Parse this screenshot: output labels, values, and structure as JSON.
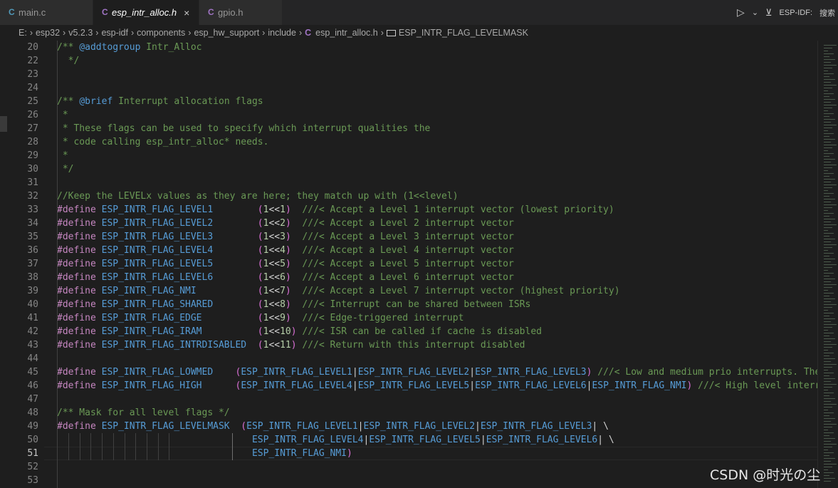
{
  "tabs": [
    {
      "icon": "C",
      "label": "main.c",
      "active": false
    },
    {
      "icon": "C",
      "label": "esp_intr_alloc.h",
      "active": true,
      "close": "×"
    },
    {
      "icon": "C",
      "label": "gpio.h",
      "active": false
    }
  ],
  "toolbar": {
    "run_icon": "run-debug-icon",
    "dropdown": "⌄",
    "esp_idf_label": "ESP-IDF:",
    "search_label": "搜索"
  },
  "breadcrumb": [
    "E:",
    "esp32",
    "v5.2.3",
    "esp-idf",
    "components",
    "esp_hw_support",
    "include",
    "esp_intr_alloc.h",
    "ESP_INTR_FLAG_LEVELMASK"
  ],
  "lines": [
    {
      "n": "20",
      "segs": [
        {
          "t": "/** ",
          "c": "cm"
        },
        {
          "t": "@addtogroup",
          "c": "tag"
        },
        {
          "t": " Intr_Alloc",
          "c": "cm"
        }
      ]
    },
    {
      "n": "22",
      "segs": [
        {
          "t": "  */",
          "c": "cm"
        }
      ]
    },
    {
      "n": "23",
      "segs": []
    },
    {
      "n": "24",
      "segs": []
    },
    {
      "n": "25",
      "segs": [
        {
          "t": "/** ",
          "c": "cm"
        },
        {
          "t": "@brief",
          "c": "tag"
        },
        {
          "t": " Interrupt allocation flags",
          "c": "cm"
        }
      ]
    },
    {
      "n": "26",
      "segs": [
        {
          "t": " *",
          "c": "cm"
        }
      ]
    },
    {
      "n": "27",
      "segs": [
        {
          "t": " * These flags can be used to specify which interrupt qualities the",
          "c": "cm"
        }
      ]
    },
    {
      "n": "28",
      "segs": [
        {
          "t": " * code calling esp_intr_alloc* needs.",
          "c": "cm"
        }
      ]
    },
    {
      "n": "29",
      "segs": [
        {
          "t": " *",
          "c": "cm"
        }
      ]
    },
    {
      "n": "30",
      "segs": [
        {
          "t": " */",
          "c": "cm"
        }
      ]
    },
    {
      "n": "31",
      "segs": []
    },
    {
      "n": "32",
      "segs": [
        {
          "t": "//Keep the LEVELx values as they are here; they match up with (1<<level)",
          "c": "cm"
        }
      ]
    },
    {
      "n": "33",
      "segs": [
        {
          "t": "#define",
          "c": "kw"
        },
        {
          "t": " "
        },
        {
          "t": "ESP_INTR_FLAG_LEVEL1",
          "c": "mac"
        },
        {
          "t": "        "
        },
        {
          "t": "(",
          "c": "par"
        },
        {
          "t": "1",
          "c": "num"
        },
        {
          "t": "<<"
        },
        {
          "t": "1",
          "c": "num"
        },
        {
          "t": ")",
          "c": "par"
        },
        {
          "t": "  ///< Accept a Level 1 interrupt vector (lowest priority)",
          "c": "cm"
        }
      ]
    },
    {
      "n": "34",
      "segs": [
        {
          "t": "#define",
          "c": "kw"
        },
        {
          "t": " "
        },
        {
          "t": "ESP_INTR_FLAG_LEVEL2",
          "c": "mac"
        },
        {
          "t": "        "
        },
        {
          "t": "(",
          "c": "par"
        },
        {
          "t": "1",
          "c": "num"
        },
        {
          "t": "<<"
        },
        {
          "t": "2",
          "c": "num"
        },
        {
          "t": ")",
          "c": "par"
        },
        {
          "t": "  ///< Accept a Level 2 interrupt vector",
          "c": "cm"
        }
      ]
    },
    {
      "n": "35",
      "segs": [
        {
          "t": "#define",
          "c": "kw"
        },
        {
          "t": " "
        },
        {
          "t": "ESP_INTR_FLAG_LEVEL3",
          "c": "mac"
        },
        {
          "t": "        "
        },
        {
          "t": "(",
          "c": "par"
        },
        {
          "t": "1",
          "c": "num"
        },
        {
          "t": "<<"
        },
        {
          "t": "3",
          "c": "num"
        },
        {
          "t": ")",
          "c": "par"
        },
        {
          "t": "  ///< Accept a Level 3 interrupt vector",
          "c": "cm"
        }
      ]
    },
    {
      "n": "36",
      "segs": [
        {
          "t": "#define",
          "c": "kw"
        },
        {
          "t": " "
        },
        {
          "t": "ESP_INTR_FLAG_LEVEL4",
          "c": "mac"
        },
        {
          "t": "        "
        },
        {
          "t": "(",
          "c": "par"
        },
        {
          "t": "1",
          "c": "num"
        },
        {
          "t": "<<"
        },
        {
          "t": "4",
          "c": "num"
        },
        {
          "t": ")",
          "c": "par"
        },
        {
          "t": "  ///< Accept a Level 4 interrupt vector",
          "c": "cm"
        }
      ]
    },
    {
      "n": "37",
      "segs": [
        {
          "t": "#define",
          "c": "kw"
        },
        {
          "t": " "
        },
        {
          "t": "ESP_INTR_FLAG_LEVEL5",
          "c": "mac"
        },
        {
          "t": "        "
        },
        {
          "t": "(",
          "c": "par"
        },
        {
          "t": "1",
          "c": "num"
        },
        {
          "t": "<<"
        },
        {
          "t": "5",
          "c": "num"
        },
        {
          "t": ")",
          "c": "par"
        },
        {
          "t": "  ///< Accept a Level 5 interrupt vector",
          "c": "cm"
        }
      ]
    },
    {
      "n": "38",
      "segs": [
        {
          "t": "#define",
          "c": "kw"
        },
        {
          "t": " "
        },
        {
          "t": "ESP_INTR_FLAG_LEVEL6",
          "c": "mac"
        },
        {
          "t": "        "
        },
        {
          "t": "(",
          "c": "par"
        },
        {
          "t": "1",
          "c": "num"
        },
        {
          "t": "<<"
        },
        {
          "t": "6",
          "c": "num"
        },
        {
          "t": ")",
          "c": "par"
        },
        {
          "t": "  ///< Accept a Level 6 interrupt vector",
          "c": "cm"
        }
      ]
    },
    {
      "n": "39",
      "segs": [
        {
          "t": "#define",
          "c": "kw"
        },
        {
          "t": " "
        },
        {
          "t": "ESP_INTR_FLAG_NMI",
          "c": "mac"
        },
        {
          "t": "           "
        },
        {
          "t": "(",
          "c": "par"
        },
        {
          "t": "1",
          "c": "num"
        },
        {
          "t": "<<"
        },
        {
          "t": "7",
          "c": "num"
        },
        {
          "t": ")",
          "c": "par"
        },
        {
          "t": "  ///< Accept a Level 7 interrupt vector (highest priority)",
          "c": "cm"
        }
      ]
    },
    {
      "n": "40",
      "segs": [
        {
          "t": "#define",
          "c": "kw"
        },
        {
          "t": " "
        },
        {
          "t": "ESP_INTR_FLAG_SHARED",
          "c": "mac"
        },
        {
          "t": "        "
        },
        {
          "t": "(",
          "c": "par"
        },
        {
          "t": "1",
          "c": "num"
        },
        {
          "t": "<<"
        },
        {
          "t": "8",
          "c": "num"
        },
        {
          "t": ")",
          "c": "par"
        },
        {
          "t": "  ///< Interrupt can be shared between ISRs",
          "c": "cm"
        }
      ]
    },
    {
      "n": "41",
      "segs": [
        {
          "t": "#define",
          "c": "kw"
        },
        {
          "t": " "
        },
        {
          "t": "ESP_INTR_FLAG_EDGE",
          "c": "mac"
        },
        {
          "t": "          "
        },
        {
          "t": "(",
          "c": "par"
        },
        {
          "t": "1",
          "c": "num"
        },
        {
          "t": "<<"
        },
        {
          "t": "9",
          "c": "num"
        },
        {
          "t": ")",
          "c": "par"
        },
        {
          "t": "  ///< Edge-triggered interrupt",
          "c": "cm"
        }
      ]
    },
    {
      "n": "42",
      "segs": [
        {
          "t": "#define",
          "c": "kw"
        },
        {
          "t": " "
        },
        {
          "t": "ESP_INTR_FLAG_IRAM",
          "c": "mac"
        },
        {
          "t": "          "
        },
        {
          "t": "(",
          "c": "par"
        },
        {
          "t": "1",
          "c": "num"
        },
        {
          "t": "<<"
        },
        {
          "t": "10",
          "c": "num"
        },
        {
          "t": ")",
          "c": "par"
        },
        {
          "t": " ///< ISR can be called if cache is disabled",
          "c": "cm"
        }
      ]
    },
    {
      "n": "43",
      "segs": [
        {
          "t": "#define",
          "c": "kw"
        },
        {
          "t": " "
        },
        {
          "t": "ESP_INTR_FLAG_INTRDISABLED",
          "c": "mac"
        },
        {
          "t": "  "
        },
        {
          "t": "(",
          "c": "par"
        },
        {
          "t": "1",
          "c": "num"
        },
        {
          "t": "<<"
        },
        {
          "t": "11",
          "c": "num"
        },
        {
          "t": ")",
          "c": "par"
        },
        {
          "t": " ///< Return with this interrupt disabled",
          "c": "cm"
        }
      ]
    },
    {
      "n": "44",
      "segs": []
    },
    {
      "n": "45",
      "segs": [
        {
          "t": "#define",
          "c": "kw"
        },
        {
          "t": " "
        },
        {
          "t": "ESP_INTR_FLAG_LOWMED",
          "c": "mac"
        },
        {
          "t": "    "
        },
        {
          "t": "(",
          "c": "par"
        },
        {
          "t": "ESP_INTR_FLAG_LEVEL1",
          "c": "mac"
        },
        {
          "t": "|"
        },
        {
          "t": "ESP_INTR_FLAG_LEVEL2",
          "c": "mac"
        },
        {
          "t": "|"
        },
        {
          "t": "ESP_INTR_FLAG_LEVEL3",
          "c": "mac"
        },
        {
          "t": ")",
          "c": "par"
        },
        {
          "t": " ///< Low and medium prio interrupts. These",
          "c": "cm"
        }
      ]
    },
    {
      "n": "46",
      "segs": [
        {
          "t": "#define",
          "c": "kw"
        },
        {
          "t": " "
        },
        {
          "t": "ESP_INTR_FLAG_HIGH",
          "c": "mac"
        },
        {
          "t": "      "
        },
        {
          "t": "(",
          "c": "par"
        },
        {
          "t": "ESP_INTR_FLAG_LEVEL4",
          "c": "mac"
        },
        {
          "t": "|"
        },
        {
          "t": "ESP_INTR_FLAG_LEVEL5",
          "c": "mac"
        },
        {
          "t": "|"
        },
        {
          "t": "ESP_INTR_FLAG_LEVEL6",
          "c": "mac"
        },
        {
          "t": "|"
        },
        {
          "t": "ESP_INTR_FLAG_NMI",
          "c": "mac"
        },
        {
          "t": ")",
          "c": "par"
        },
        {
          "t": " ///< High level interrup",
          "c": "cm"
        }
      ]
    },
    {
      "n": "47",
      "segs": []
    },
    {
      "n": "48",
      "segs": [
        {
          "t": "/** Mask for all level flags */",
          "c": "cm"
        }
      ]
    },
    {
      "n": "49",
      "segs": [
        {
          "t": "#define",
          "c": "kw"
        },
        {
          "t": " "
        },
        {
          "t": "ESP_INTR_FLAG_LEVELMASK",
          "c": "mac"
        },
        {
          "t": "  "
        },
        {
          "t": "(",
          "c": "par"
        },
        {
          "t": "ESP_INTR_FLAG_LEVEL1",
          "c": "mac"
        },
        {
          "t": "|"
        },
        {
          "t": "ESP_INTR_FLAG_LEVEL2",
          "c": "mac"
        },
        {
          "t": "|"
        },
        {
          "t": "ESP_INTR_FLAG_LEVEL3",
          "c": "mac"
        },
        {
          "t": "| \\"
        }
      ]
    },
    {
      "n": "50",
      "segs": [
        {
          "t": "                                   "
        },
        {
          "t": "ESP_INTR_FLAG_LEVEL4",
          "c": "mac"
        },
        {
          "t": "|"
        },
        {
          "t": "ESP_INTR_FLAG_LEVEL5",
          "c": "mac"
        },
        {
          "t": "|"
        },
        {
          "t": "ESP_INTR_FLAG_LEVEL6",
          "c": "mac"
        },
        {
          "t": "| \\"
        }
      ]
    },
    {
      "n": "51",
      "segs": [
        {
          "t": "                                   "
        },
        {
          "t": "ESP_INTR_FLAG_NMI",
          "c": "mac"
        },
        {
          "t": ")",
          "c": "par"
        }
      ],
      "current": true
    },
    {
      "n": "52",
      "segs": []
    },
    {
      "n": "53",
      "segs": []
    }
  ],
  "watermark": "CSDN @时光の尘",
  "colors": {
    "background": "#1e1e1e",
    "comment": "#6a9955",
    "macro": "#569cd6",
    "keyword": "#c586c0",
    "number": "#b5cea8",
    "paren": "#da70d6"
  }
}
